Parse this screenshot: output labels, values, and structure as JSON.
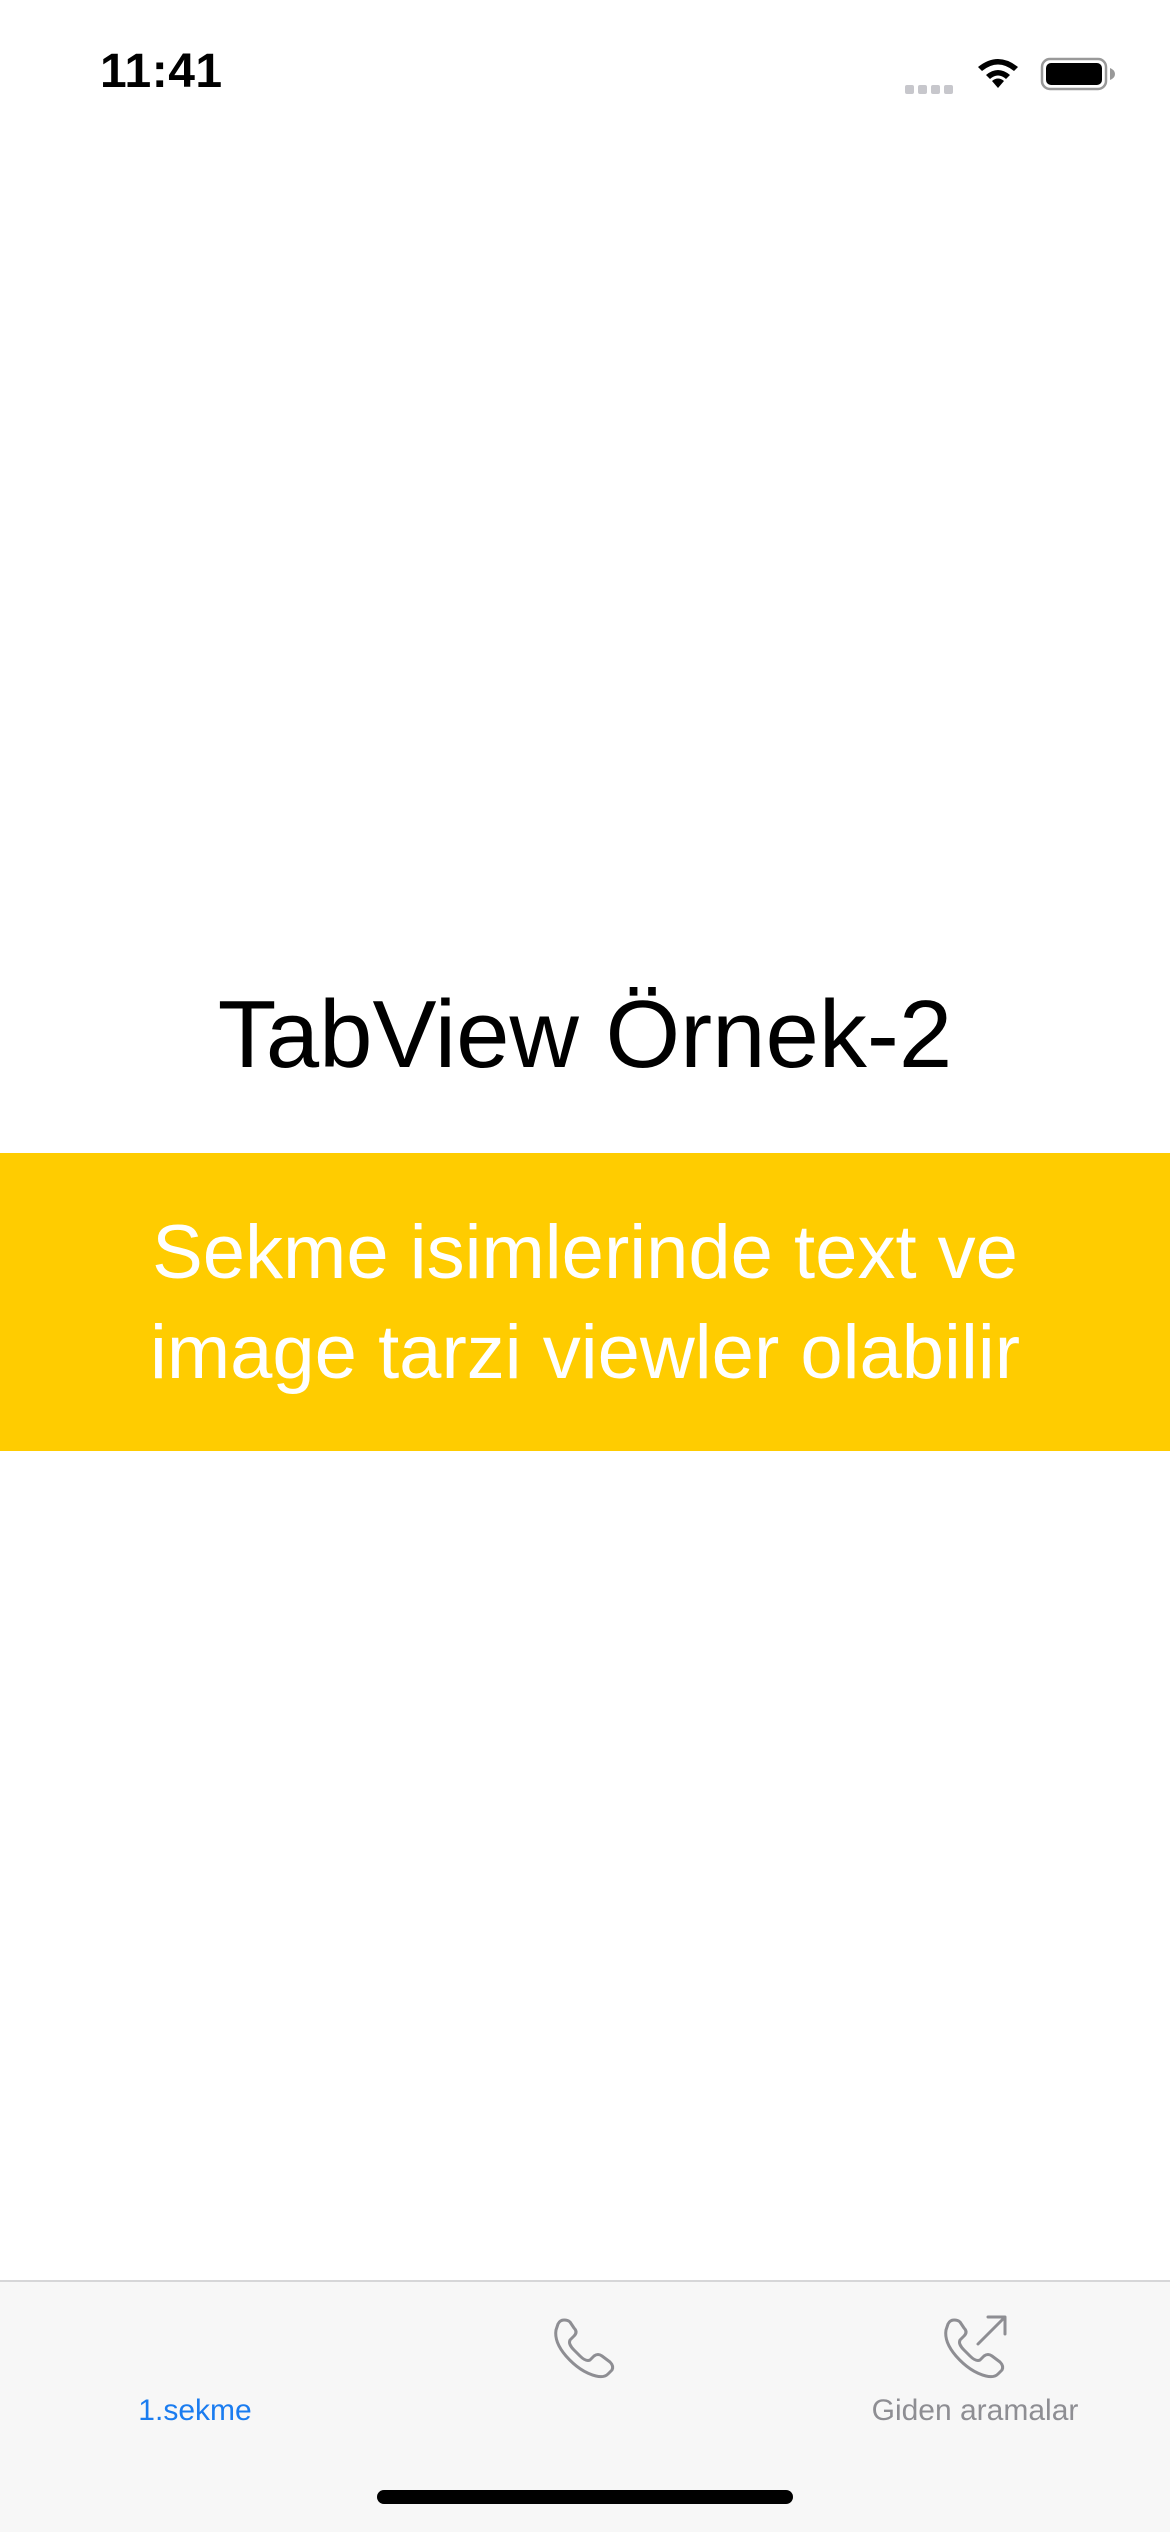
{
  "status_bar": {
    "time": "11:41"
  },
  "main": {
    "title": "TabView Örnek-2",
    "banner_text": "Sekme isimlerinde text ve image tarzi viewler olabilir",
    "banner_color": "#ffcc00"
  },
  "tab_bar": {
    "accent_color": "#1a7cf0",
    "tabs": [
      {
        "label": "1.sekme",
        "icon": null,
        "selected": true
      },
      {
        "label": "",
        "icon": "phone-icon",
        "selected": false
      },
      {
        "label": "Giden aramalar",
        "icon": "phone-outgoing-icon",
        "selected": false
      }
    ]
  }
}
